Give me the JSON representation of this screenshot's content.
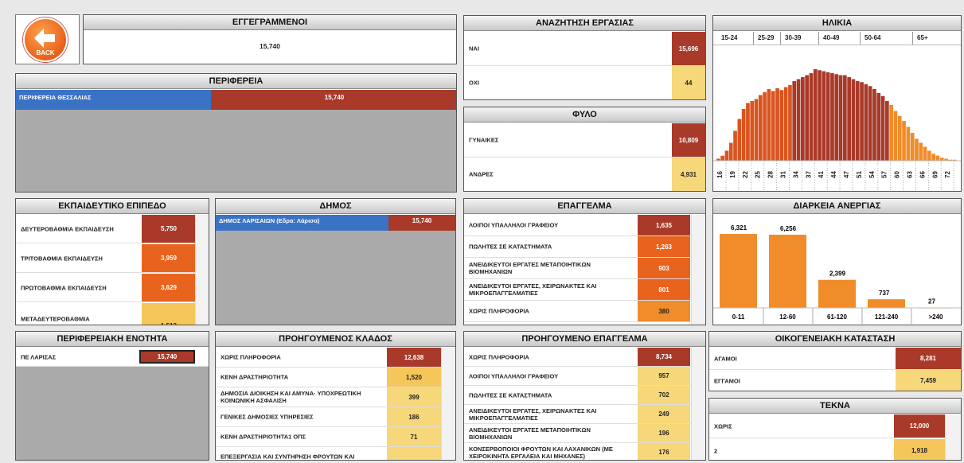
{
  "back": {
    "label": "BACK"
  },
  "registered": {
    "title": "ΕΓΓΕΓΡΑΜΜΕΝΟΙ",
    "value": "15,740"
  },
  "region": {
    "title": "ΠΕΡΙΦΕΡΕΙΑ",
    "row_label": "ΠΕΡΙΦΕΡΕΙΑ ΘΕΣΣΑΛΙΑΣ",
    "row_value": "15,740"
  },
  "job_search": {
    "title": "ΑΝΑΖΗΤΗΣΗ ΕΡΓΑΣΙΑΣ",
    "rows": [
      {
        "label": "ΝΑΙ",
        "value": "15,696"
      },
      {
        "label": "ΟΧΙ",
        "value": "44"
      }
    ]
  },
  "gender": {
    "title": "ΦΥΛΟ",
    "rows": [
      {
        "label": "ΓΥΝΑΙΚΕΣ",
        "value": "10,809"
      },
      {
        "label": "ΑΝΔΡΕΣ",
        "value": "4,931"
      }
    ]
  },
  "age": {
    "title": "ΗΛΙΚΙΑ",
    "groups": [
      "15-24",
      "25-29",
      "30-39",
      "40-49",
      "50-64",
      "65+"
    ],
    "ticks": [
      "16",
      "19",
      "22",
      "25",
      "28",
      "31",
      "34",
      "37",
      "41",
      "44",
      "47",
      "51",
      "54",
      "57",
      "60",
      "63",
      "66",
      "69",
      "72"
    ]
  },
  "education": {
    "title": "ΕΚΠΑΙΔΕΥΤΙΚΟ ΕΠΙΠΕΔΟ",
    "rows": [
      {
        "label": "ΔΕΥΤΕΡΟΒΑΘΜΙΑ ΕΚΠΑΙΔΕΥΣΗ",
        "value": "5,750"
      },
      {
        "label": "ΤΡΙΤΟΒΑΘΜΙΑ ΕΚΠΑΙΔΕΥΣΗ",
        "value": "3,959"
      },
      {
        "label": "ΠΡΩΤΟΒΑΘΜΙΑ ΕΚΠΑΙΔΕΥΣΗ",
        "value": "3,629"
      },
      {
        "label": "ΜΕΤΑΔΕΥΤΕΡΟΒΑΘΜΙΑ",
        "value": "1,513"
      }
    ]
  },
  "municipality": {
    "title": "ΔΗΜΟΣ",
    "row_label": "ΔΗΜΟΣ ΛΑΡΙΣΑΙΩΝ (Εδρα: Λάρισα)",
    "row_value": "15,740"
  },
  "profession": {
    "title": "ΕΠΑΓΓΕΛΜΑ",
    "rows": [
      {
        "label": "ΛΟΙΠΟΙ ΥΠΑΛΛΗΛΟΙ ΓΡΑΦΕΙΟΥ",
        "value": "1,635"
      },
      {
        "label": "ΠΩΛΗΤΕΣ ΣΕ ΚΑΤΑΣΤΗΜΑΤΑ",
        "value": "1,263"
      },
      {
        "label": "ΑΝΕΙΔΙΚΕΥΤΟΙ ΕΡΓΑΤΕΣ ΜΕΤΑΠΟΙΗΤΙΚΩΝ ΒΙΟΜΗΧΑΝΙΩΝ",
        "value": "903"
      },
      {
        "label": "ΑΝΕΙΔΙΚΕΥΤΟΙ ΕΡΓΑΤΕΣ, ΧΕΙΡΩΝΑΚΤΕΣ ΚΑΙ ΜΙΚΡΟΕΠΑΓΓΕΛΜΑΤΙΕΣ",
        "value": "801"
      },
      {
        "label": "ΧΩΡΙΣ ΠΛΗΡΟΦΟΡΙΑ",
        "value": "380"
      }
    ]
  },
  "duration": {
    "title": "ΔΙΑΡΚΕΙΑ ΑΝΕΡΓΙΑΣ"
  },
  "regional_unit": {
    "title": "ΠΕΡΙΦΕΡΕΙΑΚΗ ΕΝΟΤΗΤΑ",
    "row_label": "ΠΕ ΛΑΡΙΣΑΣ",
    "row_value": "15,740"
  },
  "prev_sector": {
    "title": "ΠΡΟΗΓΟΥΜΕΝΟΣ ΚΛΑΔΟΣ",
    "rows": [
      {
        "label": "ΧΩΡΙΣ ΠΛΗΡΟΦΟΡΙΑ",
        "value": "12,638"
      },
      {
        "label": "ΚΕΝΗ ΔΡΑΣΤΗΡΙΟΤΗΤΑ",
        "value": "1,520"
      },
      {
        "label": "ΔΗΜΟΣΙΑ ΔΙΟΙΚΗΣΗ ΚΑΙ ΑΜΥΝΑ· ΥΠΟΧΡΕΩΤΙΚΗ ΚΟΙΝΩΝΙΚΗ ΑΣΦΑΛΙΣΗ",
        "value": "399"
      },
      {
        "label": "ΓΕΝΙΚΕΣ ΔΗΜΟΣΙΕΣ ΥΠΗΡΕΣΙΕΣ",
        "value": "186"
      },
      {
        "label": "ΚΕΝΗ ΔΡΑΣΤΗΡΙΟΤΗΤΑ1 ΟΠΣ",
        "value": "71"
      },
      {
        "label": "ΕΠΕΞΕΡΓΑΣΙΑ ΚΑΙ ΣΥΝΤΗΡΗΣΗ ΦΡΟΥΤΩΝ ΚΑΙ",
        "value": ""
      }
    ]
  },
  "prev_profession": {
    "title": "ΠΡΟΗΓΟΥΜΕΝΟ ΕΠΑΓΓΕΛΜΑ",
    "rows": [
      {
        "label": "ΧΩΡΙΣ ΠΛΗΡΟΦΟΡΙΑ",
        "value": "8,734"
      },
      {
        "label": "ΛΟΙΠΟΙ ΥΠΑΛΛΗΛΟΙ ΓΡΑΦΕΙΟΥ",
        "value": "957"
      },
      {
        "label": "ΠΩΛΗΤΕΣ ΣΕ ΚΑΤΑΣΤΗΜΑΤΑ",
        "value": "702"
      },
      {
        "label": "ΑΝΕΙΔΙΚΕΥΤΟΙ ΕΡΓΑΤΕΣ, ΧΕΙΡΩΝΑΚΤΕΣ ΚΑΙ ΜΙΚΡΟΕΠΑΓΓΕΛΜΑΤΙΕΣ",
        "value": "249"
      },
      {
        "label": "ΑΝΕΙΔΙΚΕΥΤΟΙ ΕΡΓΑΤΕΣ ΜΕΤΑΠΟΙΗΤΙΚΩΝ ΒΙΟΜΗΧΑΝΙΩΝ",
        "value": "196"
      },
      {
        "label": "ΚΟΝΣΕΡΒΟΠΟΙΟΙ ΦΡΟΥΤΩΝ ΚΑΙ ΛΑΧΑΝΙΚΩΝ (ΜΕ ΧΕΙΡΟΚΙΝΗΤΑ ΕΡΓΑΛΕΙΑ ΚΑΙ ΜΗΧΑΝΕΣ)",
        "value": "176"
      }
    ]
  },
  "marital": {
    "title": "ΟΙΚΟΓΕΝΕΙΑΚΗ ΚΑΤΑΣΤΑΣΗ",
    "rows": [
      {
        "label": "ΑΓΑΜΟΙ",
        "value": "8,281"
      },
      {
        "label": "ΕΓΓΑΜΟΙ",
        "value": "7,459"
      }
    ]
  },
  "children": {
    "title": "ΤΕΚΝΑ",
    "rows": [
      {
        "label": "ΧΩΡΙΣ",
        "value": "12,000"
      },
      {
        "label": "2",
        "value": "1,918"
      }
    ]
  },
  "chart_data": [
    {
      "type": "bar",
      "title": "ΔΙΑΡΚΕΙΑ ΑΝΕΡΓΙΑΣ",
      "categories": [
        "0-11",
        "12-60",
        "61-120",
        "121-240",
        ">240"
      ],
      "values": [
        6321,
        6256,
        2399,
        737,
        27
      ],
      "value_labels": [
        "6,321",
        "6,256",
        "2,399",
        "737",
        "27"
      ],
      "color": "#f08c2a"
    },
    {
      "type": "bar",
      "title": "ΗΛΙΚΙΑ",
      "x": [
        16,
        17,
        18,
        19,
        20,
        21,
        22,
        23,
        24,
        25,
        26,
        27,
        28,
        29,
        30,
        31,
        32,
        33,
        34,
        35,
        36,
        37,
        38,
        39,
        40,
        41,
        42,
        43,
        44,
        45,
        46,
        47,
        48,
        49,
        50,
        51,
        52,
        53,
        54,
        55,
        56,
        57,
        58,
        59,
        60,
        61,
        62,
        63,
        64,
        65,
        66,
        67,
        68,
        69,
        70,
        71,
        72,
        73
      ],
      "values": [
        2,
        5,
        10,
        18,
        30,
        42,
        52,
        58,
        60,
        62,
        66,
        69,
        72,
        70,
        73,
        71,
        74,
        76,
        80,
        82,
        84,
        86,
        88,
        92,
        91,
        90,
        89,
        88,
        87,
        86,
        86,
        84,
        82,
        80,
        79,
        77,
        75,
        72,
        68,
        65,
        60,
        56,
        50,
        45,
        40,
        34,
        28,
        22,
        18,
        14,
        10,
        7,
        5,
        3,
        2,
        1,
        1,
        0
      ],
      "colors": [
        "#f08c2a",
        "#d9541e",
        "#a93a2a"
      ]
    }
  ]
}
